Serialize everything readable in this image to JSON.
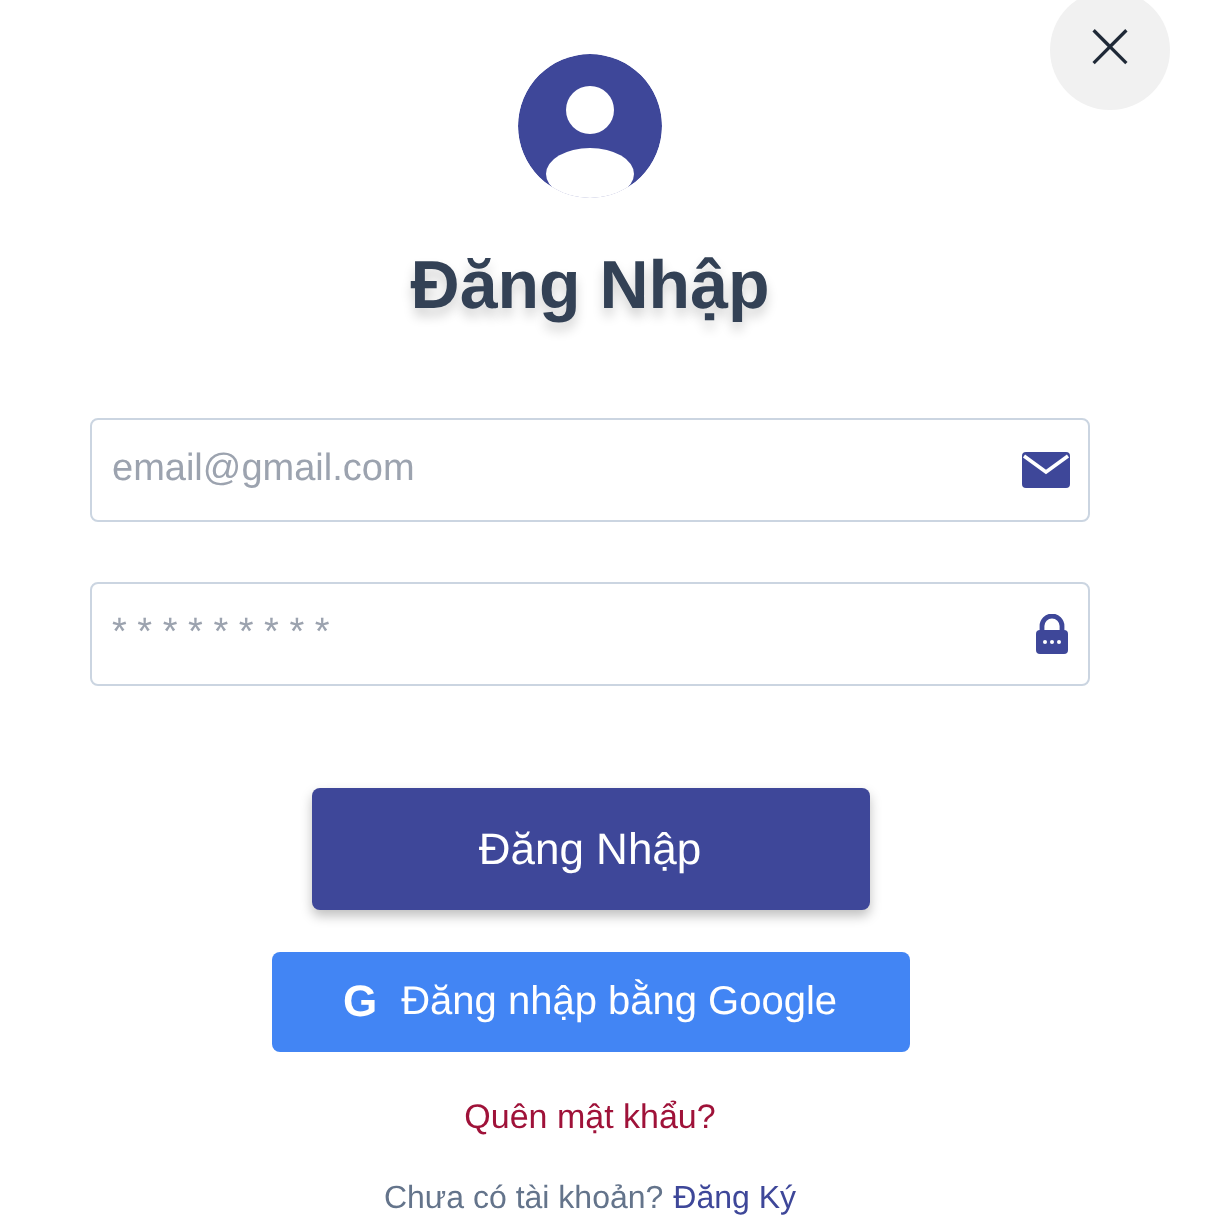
{
  "close_button": {
    "label": "×"
  },
  "title": "Đăng Nhập",
  "fields": [
    {
      "kind": "email",
      "placeholder": "email@gmail.com"
    },
    {
      "kind": "password",
      "placeholder": "* * * * * * * * *"
    }
  ],
  "login_button": {
    "label": "Đăng Nhập"
  },
  "google_button": {
    "icon": "G",
    "label": "Đăng nhập bằng Google"
  },
  "forgot_link": "Quên mật khẩu?",
  "signup": {
    "prompt": "Chưa có tài khoản?",
    "link": "Đăng Ký"
  }
}
